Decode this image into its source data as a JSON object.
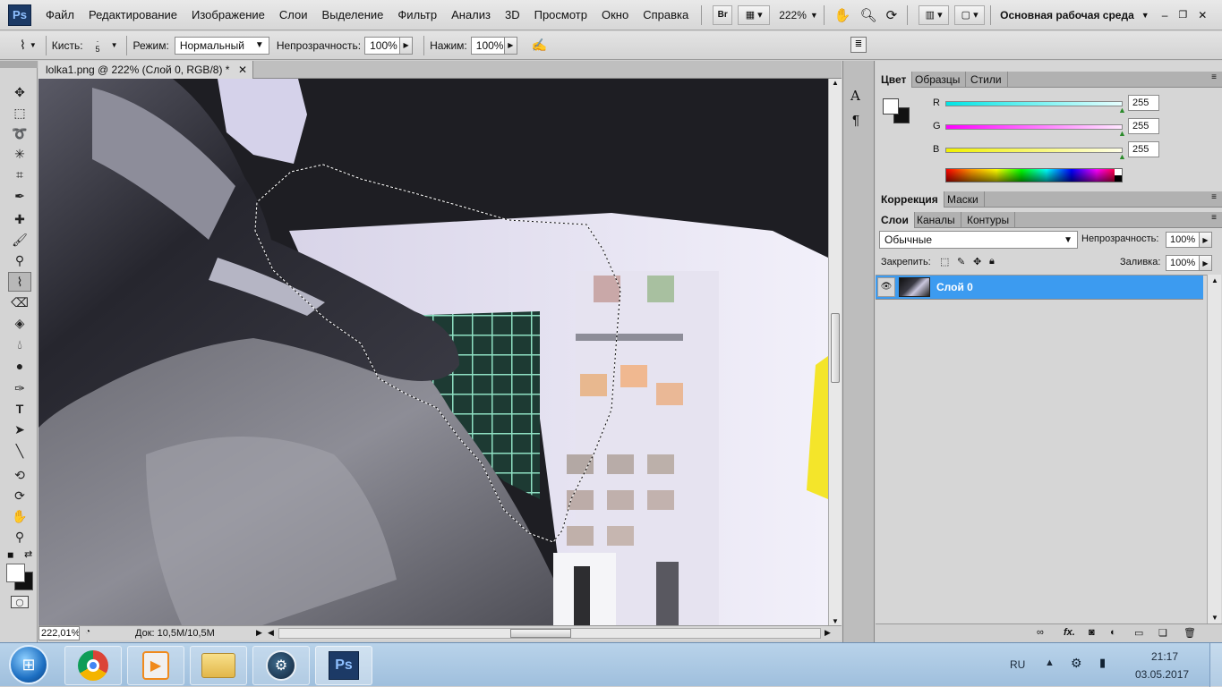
{
  "app": {
    "logo": "Ps"
  },
  "menu": [
    "Файл",
    "Редактирование",
    "Изображение",
    "Слои",
    "Выделение",
    "Фильтр",
    "Анализ",
    "3D",
    "Просмотр",
    "Окно",
    "Справка"
  ],
  "menubar_tools": {
    "bridge": "Br",
    "zoom": "222%",
    "workspace": "Основная рабочая среда"
  },
  "options": {
    "brush_label": "Кисть:",
    "brush_size": "5",
    "mode_label": "Режим:",
    "mode_value": "Нормальный",
    "opacity_label": "Непрозрачность:",
    "opacity_value": "100%",
    "pressure_label": "Нажим:",
    "pressure_value": "100%"
  },
  "document": {
    "tab_title": "lolka1.png @ 222% (Слой 0, RGB/8) *",
    "zoom_status": "222,01%",
    "doc_status": "Док: 10,5M/10,5M"
  },
  "color_panel": {
    "tabs": [
      "Цвет",
      "Образцы",
      "Стили"
    ],
    "channels": [
      {
        "label": "R",
        "value": "255",
        "color": "#00e5e5"
      },
      {
        "label": "G",
        "value": "255",
        "color": "#ff00ff"
      },
      {
        "label": "B",
        "value": "255",
        "color": "#f0f000"
      }
    ]
  },
  "adjust_panel": {
    "tabs": [
      "Коррекция",
      "Маски"
    ]
  },
  "layers_panel": {
    "tabs": [
      "Слои",
      "Каналы",
      "Контуры"
    ],
    "blend_mode": "Обычные",
    "opacity_label": "Непрозрачность:",
    "opacity_value": "100%",
    "lock_label": "Закрепить:",
    "fill_label": "Заливка:",
    "fill_value": "100%",
    "layers": [
      {
        "name": "Слой 0",
        "selected": true
      }
    ],
    "footer_fx": "fx."
  },
  "taskbar": {
    "lang": "RU",
    "time": "21:17",
    "date": "03.05.2017",
    "ps_label": "Ps"
  },
  "colors": {
    "selection_blue": "#3c9bf0",
    "ps_dark": "#1c3a66"
  }
}
